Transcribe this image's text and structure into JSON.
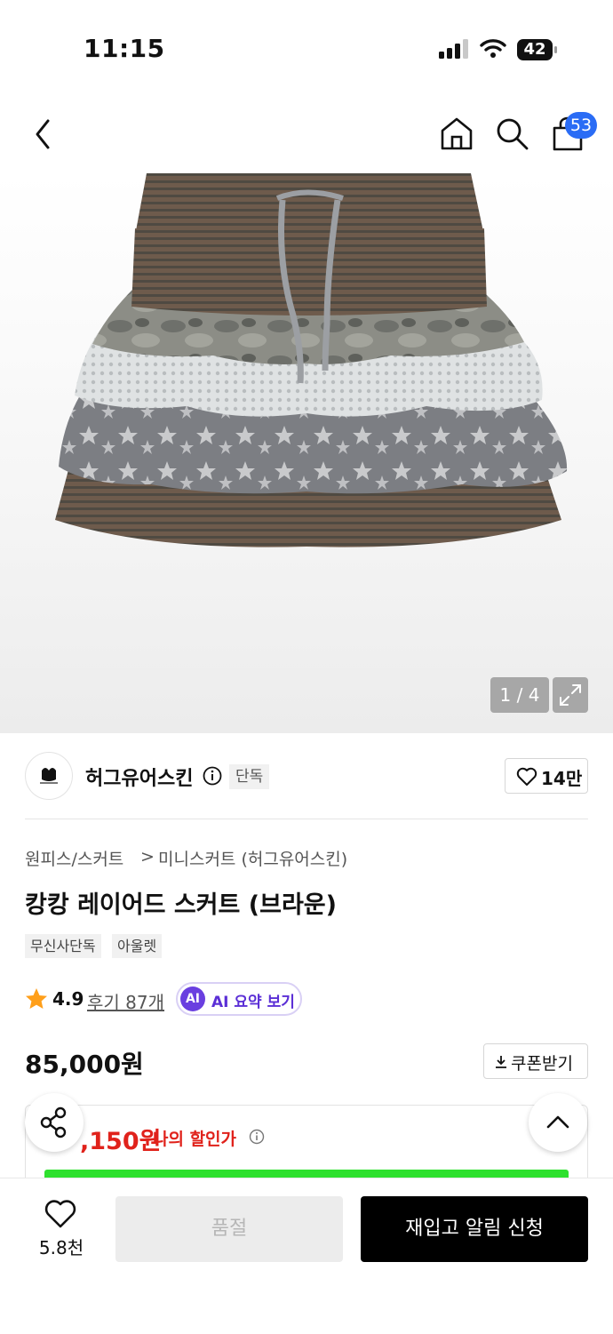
{
  "status_bar": {
    "time": "11:15",
    "battery": "42"
  },
  "header": {
    "cart_count": "53"
  },
  "gallery": {
    "counter": "1 / 4"
  },
  "brand": {
    "name": "허그유어스킨",
    "badge": "단독",
    "likes": "14만"
  },
  "breadcrumb": {
    "category": "원피스/스커트",
    "separator": ">",
    "subcategory": "미니스커트 (허그유어스킨)"
  },
  "product": {
    "title": "캉캉 레이어드 스커트 (브라운)",
    "tags": [
      "무신사단독",
      "아울렛"
    ],
    "rating": "4.9",
    "reviews": "후기 87개",
    "ai_badge": "AI",
    "ai_label": "AI 요약 보기",
    "price": "85,000원",
    "coupon_label": "쿠폰받기",
    "discount_price": ",150원",
    "discount_label": "나의 할인가"
  },
  "bottom_bar": {
    "wish_count": "5.8천",
    "soldout_label": "품절",
    "restock_label": "재입고 알림 신청"
  },
  "colors": {
    "accent_blue": "#2a6cf5",
    "discount_red": "#e0221b",
    "ai_purple": "#6a3fe0",
    "progress_green": "#2ee02e",
    "star_orange": "#ff9f1a"
  }
}
